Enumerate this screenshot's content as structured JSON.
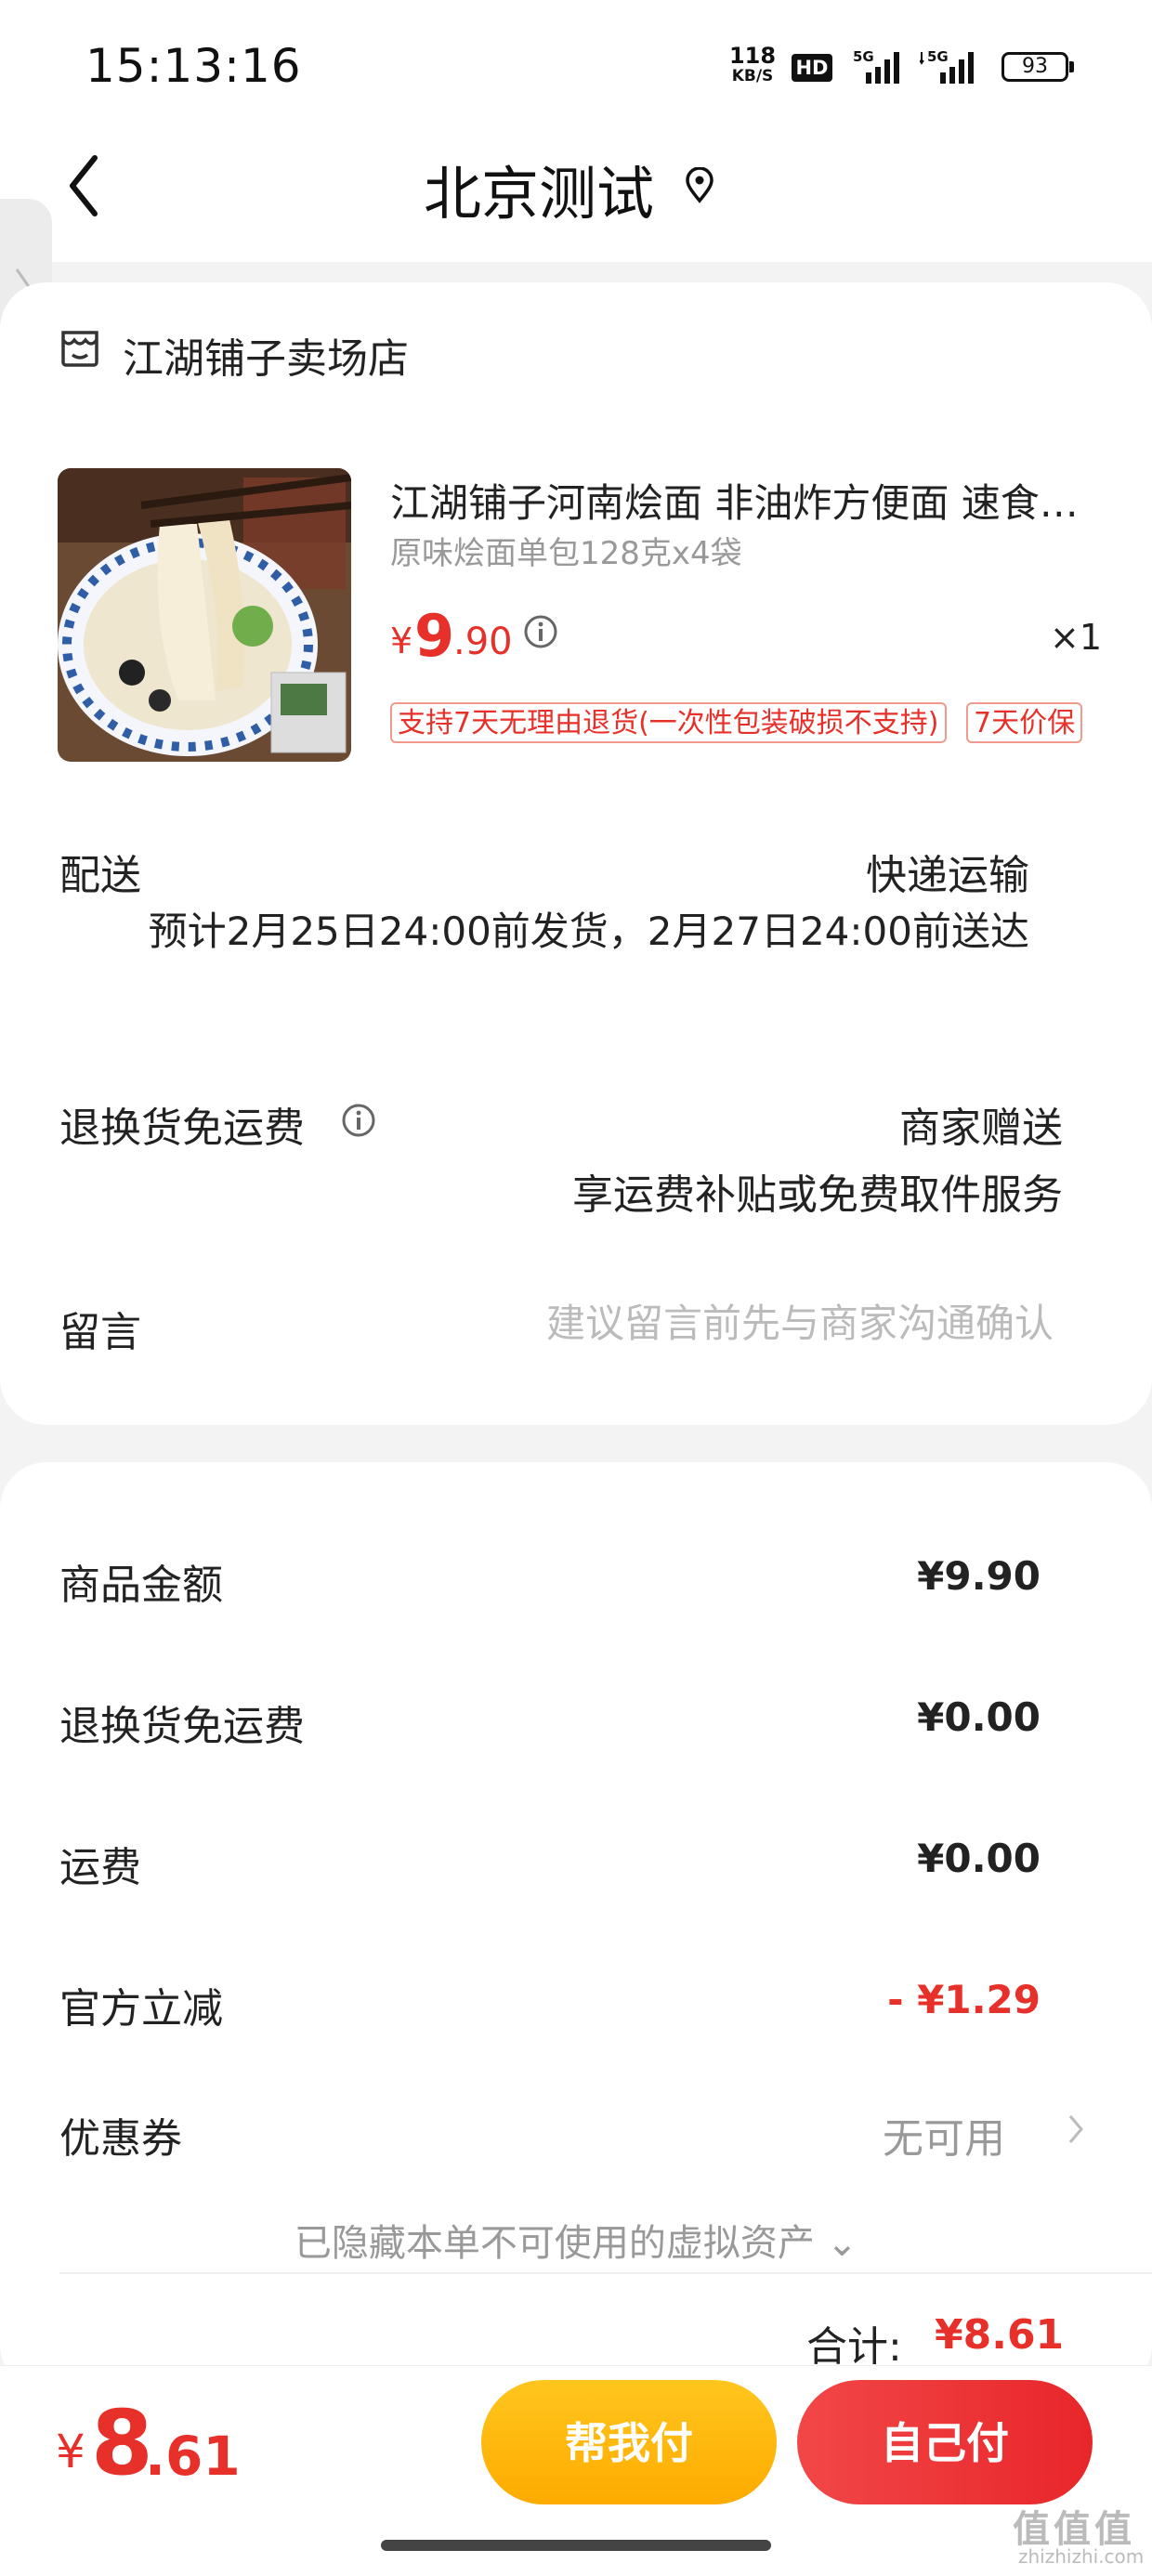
{
  "status_bar": {
    "time": "15:13:16",
    "speed_value": "118",
    "speed_unit": "KB/S",
    "hd": "HD",
    "sig1": "5G",
    "sig2": "5G",
    "battery": "93"
  },
  "header": {
    "title": "北京测试",
    "back_icon": "back-chevron-icon",
    "location_icon": "location-pin-icon"
  },
  "store": {
    "icon": "store-icon",
    "name": "江湖铺子卖场店"
  },
  "product": {
    "title": "江湖铺子河南烩面 非油炸方便面 速食面 懒人面",
    "spec": "原味烩面单包128克x4袋",
    "price_symbol": "¥",
    "price_int": "9",
    "price_dec": ".90",
    "quantity": "×1",
    "tags": [
      "支持7天无理由退货(一次性包装破损不支持)",
      "7天价保"
    ]
  },
  "delivery": {
    "label": "配送",
    "method": "快递运输",
    "estimate": "预计2月25日24:00前发货，2月27日24:00前送达"
  },
  "return_shipping": {
    "label": "退换货免运费",
    "value1": "商家赠送",
    "value2": "享运费补贴或免费取件服务"
  },
  "message": {
    "label": "留言",
    "placeholder": "建议留言前先与商家沟通确认"
  },
  "summary": {
    "rows": [
      {
        "label": "商品金额",
        "value": "¥9.90"
      },
      {
        "label": "退换货免运费",
        "value": "¥0.00"
      },
      {
        "label": "运费",
        "value": "¥0.00"
      },
      {
        "label": "官方立减",
        "value": "- ¥1.29"
      }
    ],
    "coupon_label": "优惠券",
    "coupon_value": "无可用",
    "hidden_assets": "已隐藏本单不可使用的虚拟资产 ⌄",
    "total_label": "合计:",
    "total_value": "¥8.61"
  },
  "bottom": {
    "price_symbol": "¥",
    "price_int": "8",
    "price_dec": ".61",
    "help_pay": "帮我付",
    "self_pay": "自己付"
  },
  "watermark": {
    "main": "值值值",
    "sub": "zhizhizhi.com"
  },
  "colors": {
    "accent_red": "#e8302a",
    "button_yellow": "#ffc61e",
    "button_red": "#f24747"
  }
}
